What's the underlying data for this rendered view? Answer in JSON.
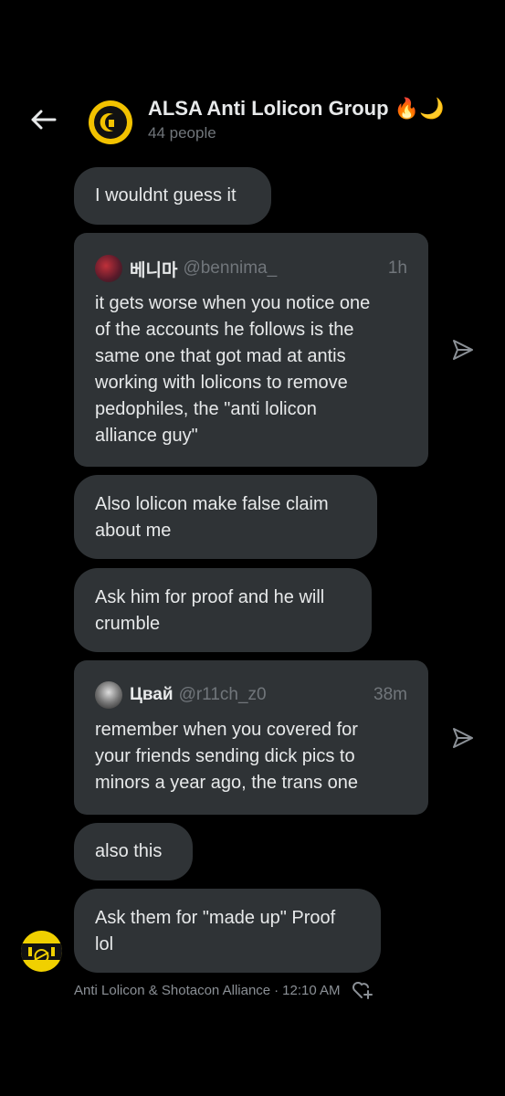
{
  "header": {
    "title": "ALSA Anti Lolicon Group 🔥🌙",
    "subtitle": "44 people"
  },
  "messages": [
    {
      "text": "I wouldnt guess it"
    },
    {
      "quote": {
        "name": "베니마",
        "handle": "@bennima_",
        "time": "1h",
        "body": "it gets worse when you notice one\nof the accounts he follows is the\nsame one that got mad at antis\nworking with lolicons to remove\npedophiles, the \"anti lolicon\nalliance guy\""
      }
    },
    {
      "text": "Also lolicon make false claim\nabout me"
    },
    {
      "text": "Ask him for proof and he will\ncrumble"
    },
    {
      "quote": {
        "name": "Цвай",
        "handle": "@r11ch_z0",
        "time": "38m",
        "body": "remember when you covered for\nyour friends sending dick pics to\nminors a year ago, the trans one"
      }
    },
    {
      "text": "also this"
    },
    {
      "text": "Ask them for \"made up\" Proof\nlol"
    }
  ],
  "footer": {
    "sender": "Anti Lolicon & Shotacon Alliance",
    "separator": "·",
    "time": "12:10 AM"
  },
  "icons": {
    "back": "arrow-left-icon",
    "share": "send-icon",
    "react": "heart-plus-icon"
  },
  "colors": {
    "background": "#000000",
    "bubble": "#2f3336",
    "text": "#e7e9ea",
    "muted": "#71767b",
    "avatar_yellow": "#f2c200"
  }
}
